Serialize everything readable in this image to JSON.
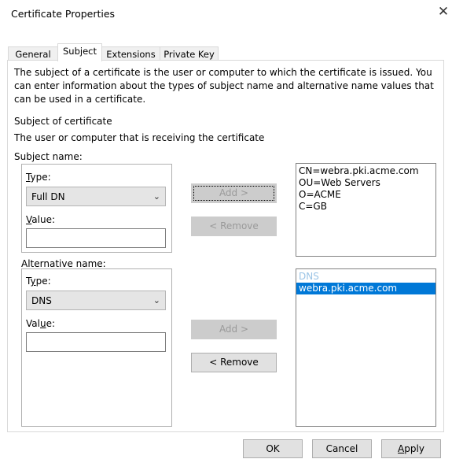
{
  "window": {
    "title": "Certificate Properties",
    "close_glyph": "✕"
  },
  "tabs": [
    {
      "label": "General",
      "active": false
    },
    {
      "label": "Subject",
      "active": true
    },
    {
      "label": "Extensions",
      "active": false
    },
    {
      "label": "Private Key",
      "active": false
    }
  ],
  "intro": {
    "line1": "The subject of a certificate is the user or computer to which the certificate is issued. You",
    "line2": "can enter information about the types of subject name and alternative name values that",
    "line3": "can be used in a certificate."
  },
  "subject_section": {
    "heading": "Subject of certificate",
    "description": "The user or computer that is receiving the certificate"
  },
  "subject_name": {
    "group_label": "Subject name:",
    "type_label": {
      "accel": "T",
      "rest": "ype:"
    },
    "type_value": "Full DN",
    "value_label": {
      "accel": "V",
      "rest": "alue:"
    },
    "value_text": "",
    "add_label": "Add >",
    "remove_label": "< Remove",
    "list_items": [
      "CN=webra.pki.acme.com",
      "OU=Web Servers",
      "O=ACME",
      "C=GB"
    ]
  },
  "alternative_name": {
    "group_label": "Alternative name:",
    "type_label": {
      "pre": "T",
      "accel": "y",
      "rest": "pe:"
    },
    "type_value": "DNS",
    "value_label": {
      "pre": "Val",
      "accel": "u",
      "rest": "e:"
    },
    "value_text": "",
    "add_label": "Add >",
    "remove_label": "< Remove",
    "list_header": "DNS",
    "list_items": [
      "webra.pki.acme.com"
    ]
  },
  "footer": {
    "ok_label": "OK",
    "cancel_label": "Cancel",
    "apply_label": {
      "accel": "A",
      "rest": "pply"
    }
  },
  "colors": {
    "selection": "#0078d7",
    "header_text": "#9bc4e6",
    "disabled_text": "#9a9a9a"
  },
  "icons": {
    "dropdown": "chevron-down-icon",
    "close": "close-icon"
  }
}
